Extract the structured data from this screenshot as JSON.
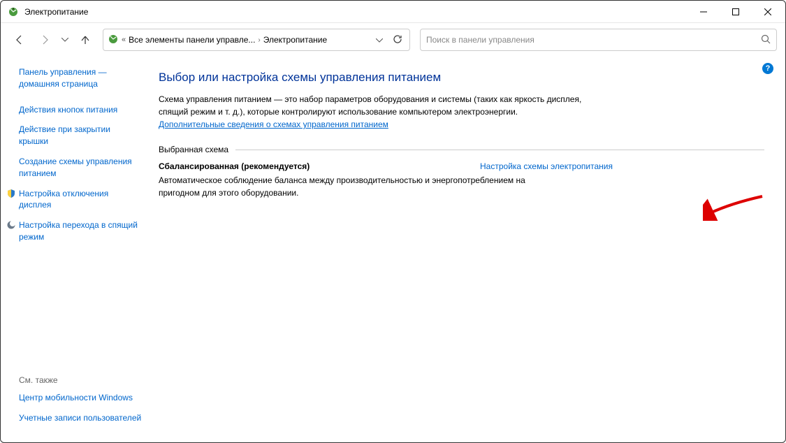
{
  "window": {
    "title": "Электропитание"
  },
  "breadcrumb": {
    "root": "Все элементы панели управле...",
    "current": "Электропитание"
  },
  "search": {
    "placeholder": "Поиск в панели управления"
  },
  "sidebar": {
    "home": "Панель управления — домашняя страница",
    "links": {
      "power_buttons": "Действия кнопок питания",
      "lid_close": "Действие при закрытии крышки",
      "create_plan": "Создание схемы управления питанием",
      "display_off": "Настройка отключения дисплея",
      "sleep": "Настройка перехода в спящий режим"
    },
    "see_also": "См. также",
    "mobility": "Центр мобильности Windows",
    "accounts": "Учетные записи пользователей"
  },
  "main": {
    "heading": "Выбор или настройка схемы управления питанием",
    "intro": "Схема управления питанием — это набор параметров оборудования и системы (таких как яркость дисплея, спящий режим и т. д.), которые контролируют использование компьютером электроэнергии.",
    "learn_more": "Дополнительные сведения о схемах управления питанием",
    "section_label": "Выбранная схема",
    "plan_name": "Сбалансированная (рекомендуется)",
    "plan_link": "Настройка схемы электропитания",
    "plan_desc": "Автоматическое соблюдение баланса между производительностью и энергопотреблением на пригодном для этого оборудовании."
  }
}
